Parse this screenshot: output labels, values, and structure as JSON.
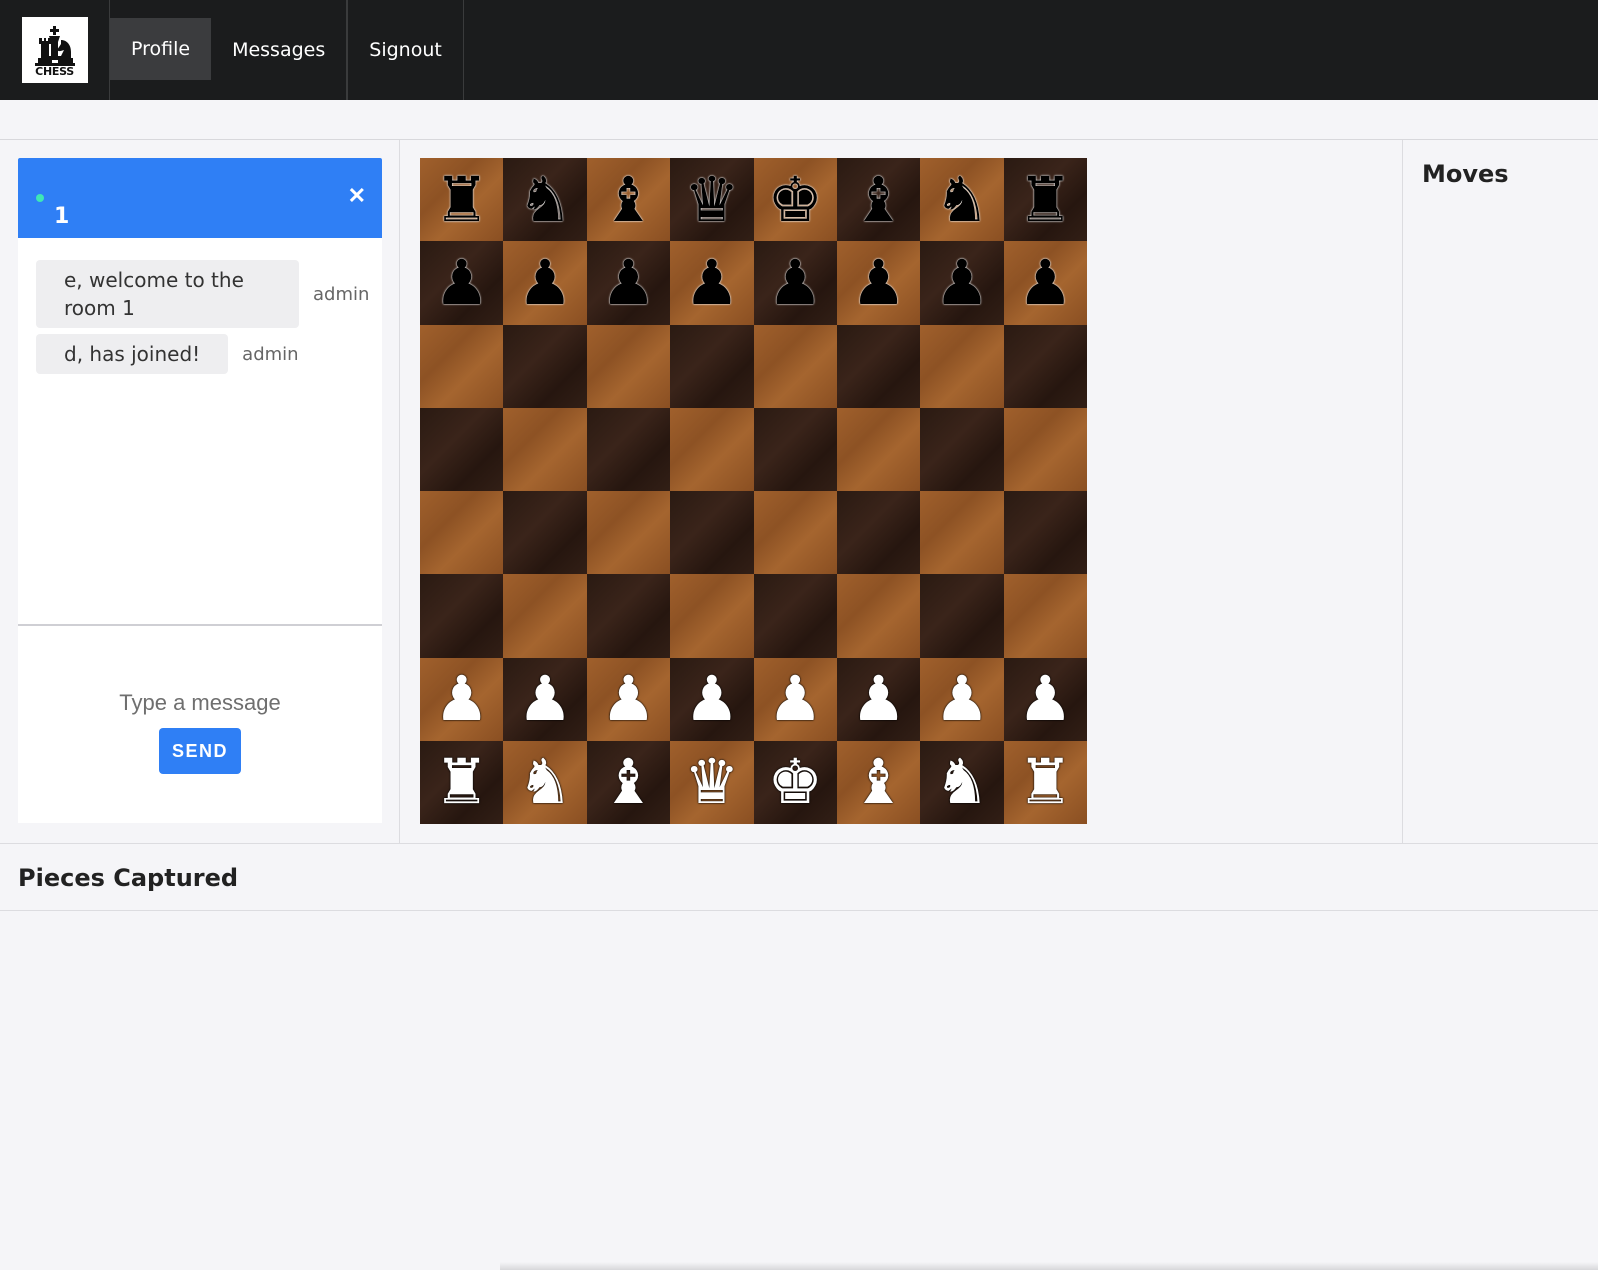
{
  "app": {
    "logo_text": "CHESS"
  },
  "nav": {
    "items": [
      {
        "label": "Profile",
        "active": true
      },
      {
        "label": "Messages",
        "active": false
      },
      {
        "label": "Signout",
        "active": false
      }
    ]
  },
  "chat": {
    "room_name": "1",
    "status": "online",
    "close_icon": "close-icon",
    "messages": [
      {
        "text": "e, welcome to the room 1",
        "sender": "admin"
      },
      {
        "text": "d, has joined!",
        "sender": "admin"
      }
    ],
    "input_placeholder": "Type a message",
    "send_label": "SEND"
  },
  "board": {
    "rows": [
      [
        "br",
        "bn",
        "bb",
        "bq",
        "bk",
        "bb",
        "bn",
        "br"
      ],
      [
        "bp",
        "bp",
        "bp",
        "bp",
        "bp",
        "bp",
        "bp",
        "bp"
      ],
      [
        "",
        "",
        "",
        "",
        "",
        "",
        "",
        ""
      ],
      [
        "",
        "",
        "",
        "",
        "",
        "",
        "",
        ""
      ],
      [
        "",
        "",
        "",
        "",
        "",
        "",
        "",
        ""
      ],
      [
        "",
        "",
        "",
        "",
        "",
        "",
        "",
        ""
      ],
      [
        "wp",
        "wp",
        "wp",
        "wp",
        "wp",
        "wp",
        "wp",
        "wp"
      ],
      [
        "wr",
        "wn",
        "wb",
        "wq",
        "wk",
        "wb",
        "wn",
        "wr"
      ]
    ],
    "colors": {
      "light": "#9a5c29",
      "dark": "#2c1b13"
    }
  },
  "moves": {
    "title": "Moves",
    "list": []
  },
  "captured": {
    "title": "Pieces Captured",
    "list": []
  },
  "colors": {
    "topbar": "#1b1c1d",
    "accent": "#2f7ff5",
    "online": "#3ee8b5"
  }
}
